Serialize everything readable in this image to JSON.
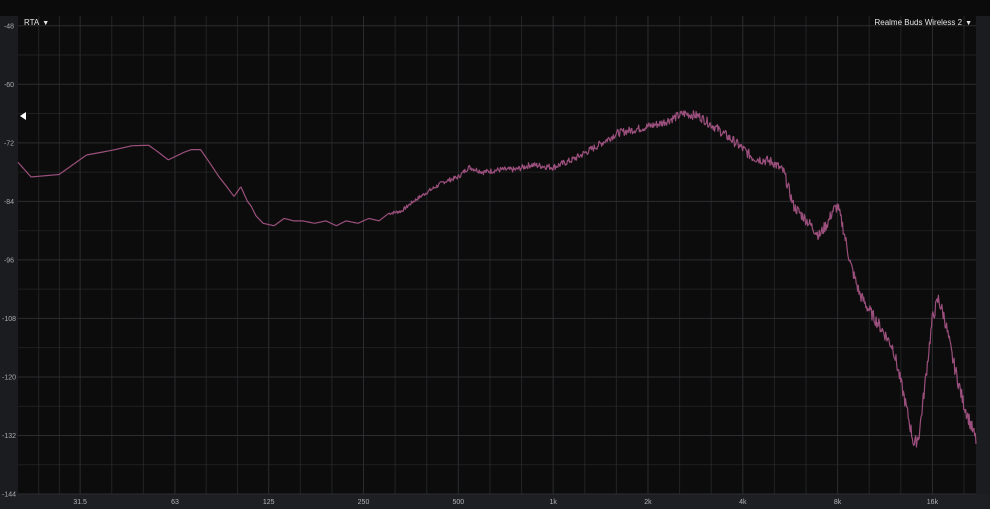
{
  "controls": {
    "rta_label": "RTA",
    "device_label": "Realme Buds Wireless 2",
    "dropdown_arrow": "▼"
  },
  "colors": {
    "background": "#0c0c0c",
    "grid": "#2c2d30",
    "trace": "#9a4f7c"
  },
  "chart_data": {
    "type": "line",
    "x_scale": "log",
    "xlim": [
      20,
      22000
    ],
    "ylim": [
      -144,
      -46
    ],
    "y_ticks": [
      -48,
      -60,
      -72,
      -84,
      -96,
      -108,
      -120,
      -132,
      -144
    ],
    "x_ticks": [
      {
        "value": 31.5,
        "label": "31.5"
      },
      {
        "value": 63,
        "label": "63"
      },
      {
        "value": 125,
        "label": "125"
      },
      {
        "value": 250,
        "label": "250"
      },
      {
        "value": 500,
        "label": "500"
      },
      {
        "value": 1000,
        "label": "1k"
      },
      {
        "value": 2000,
        "label": "2k"
      },
      {
        "value": 4000,
        "label": "4k"
      },
      {
        "value": 8000,
        "label": "8k"
      },
      {
        "value": 16000,
        "label": "16k"
      }
    ],
    "legend": "top-right",
    "grid": true,
    "series": [
      {
        "name": "Realme Buds Wireless 2",
        "x": [
          20,
          22,
          27,
          33,
          40,
          46,
          52,
          56,
          60,
          67,
          71,
          76,
          82,
          87,
          92,
          97,
          102,
          107,
          110,
          114,
          120,
          130,
          140,
          150,
          160,
          175,
          190,
          205,
          220,
          240,
          260,
          280,
          300,
          330,
          360,
          400,
          450,
          500,
          540,
          600,
          680,
          760,
          850,
          1000,
          1150,
          1350,
          1600,
          1900,
          2200,
          2600,
          2900,
          3300,
          3800,
          4300,
          5000,
          5400,
          5800,
          6400,
          7000,
          7500,
          7700,
          8000,
          8300,
          8800,
          9400,
          10000,
          11000,
          12000,
          13000,
          14000,
          14500,
          15000,
          16000,
          16700,
          17500,
          18500,
          20000,
          22000
        ],
        "y": [
          -76,
          -79,
          -78.5,
          -74.5,
          -73.5,
          -72.6,
          -72.5,
          -74,
          -75.5,
          -74,
          -73.4,
          -73.4,
          -76.5,
          -79,
          -81,
          -83,
          -81,
          -84,
          -85,
          -87,
          -88.5,
          -89,
          -87.5,
          -88,
          -88,
          -88.5,
          -88,
          -89,
          -88,
          -88.5,
          -87.5,
          -88,
          -86.5,
          -86,
          -84,
          -82,
          -80,
          -79,
          -77,
          -78,
          -77.5,
          -77.5,
          -76.5,
          -77,
          -75.5,
          -73,
          -70,
          -69,
          -68,
          -66,
          -66.5,
          -69,
          -72,
          -75,
          -76,
          -78,
          -85,
          -88,
          -91,
          -88,
          -86,
          -85,
          -89,
          -97,
          -103,
          -106,
          -110,
          -114,
          -124,
          -134,
          -132,
          -124,
          -108,
          -104,
          -108,
          -116,
          -125,
          -133
        ]
      }
    ]
  }
}
